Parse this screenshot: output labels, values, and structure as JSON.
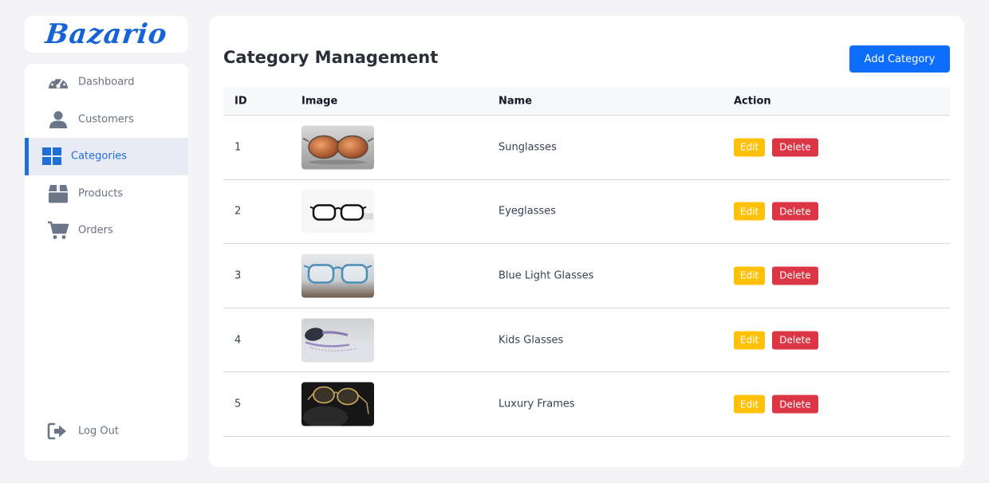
{
  "brand": {
    "logo_text": "Bazario",
    "color": "#1563d6"
  },
  "sidebar": {
    "items": [
      {
        "label": "Dashboard",
        "icon": "dashboard-gauge-icon",
        "active": false
      },
      {
        "label": "Customers",
        "icon": "user-icon",
        "active": false
      },
      {
        "label": "Categories",
        "icon": "grid-icon",
        "active": true
      },
      {
        "label": "Products",
        "icon": "box-icon",
        "active": false
      },
      {
        "label": "Orders",
        "icon": "cart-icon",
        "active": false
      }
    ],
    "logout": {
      "label": "Log Out",
      "icon": "logout-icon"
    }
  },
  "main": {
    "title": "Category Management",
    "add_button": "Add Category",
    "table": {
      "headers": {
        "id": "ID",
        "image": "Image",
        "name": "Name",
        "action": "Action"
      },
      "rows": [
        {
          "id": "1",
          "name": "Sunglasses",
          "image": "sunglasses-image",
          "edit": "Edit",
          "delete": "Delete"
        },
        {
          "id": "2",
          "name": "Eyeglasses",
          "image": "eyeglasses-image",
          "edit": "Edit",
          "delete": "Delete"
        },
        {
          "id": "3",
          "name": "Blue Light Glasses",
          "image": "blue-light-glasses-image",
          "edit": "Edit",
          "delete": "Delete"
        },
        {
          "id": "4",
          "name": "Kids Glasses",
          "image": "kids-glasses-image",
          "edit": "Edit",
          "delete": "Delete"
        },
        {
          "id": "5",
          "name": "Luxury Frames",
          "image": "luxury-frames-image",
          "edit": "Edit",
          "delete": "Delete"
        }
      ]
    }
  },
  "colors": {
    "primary": "#0d6efd",
    "active_nav": "#1f6fd6",
    "edit": "#ffc107",
    "delete": "#dc3545"
  }
}
